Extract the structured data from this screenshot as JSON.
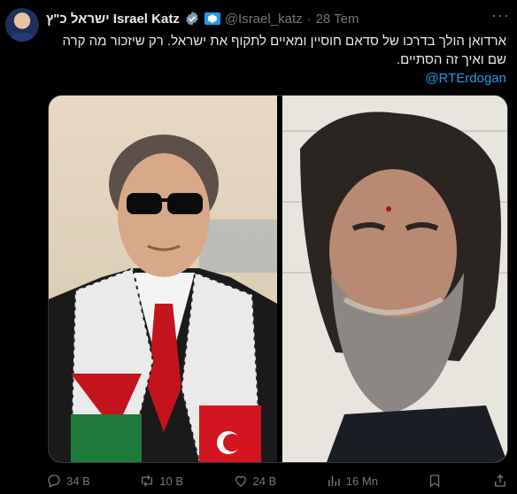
{
  "tweet": {
    "display_name": "ישראל כ\"ץ Israel Katz",
    "handle": "@Israel_katz",
    "separator": "·",
    "date": "28 Tem",
    "text": "ארדואן הולך בדרכו של סדאם חוסיין ומאיים לתקוף את ישראל. רק שיזכור מה קרה שם ואיך זה הסתיים.",
    "mention": "@RTErdogan",
    "verified_color": "#829aab",
    "accent_color": "#1d9bf0"
  },
  "actions": {
    "replies": "34 B",
    "reposts": "10 B",
    "likes": "24 B",
    "views": "16 Mn"
  },
  "icons": {
    "verified": "verified-badge-icon",
    "government": "government-flag-icon",
    "more": "more-icon",
    "reply": "reply-icon",
    "repost": "repost-icon",
    "like": "heart-icon",
    "views": "views-icon",
    "bookmark": "bookmark-icon",
    "share": "share-icon"
  }
}
